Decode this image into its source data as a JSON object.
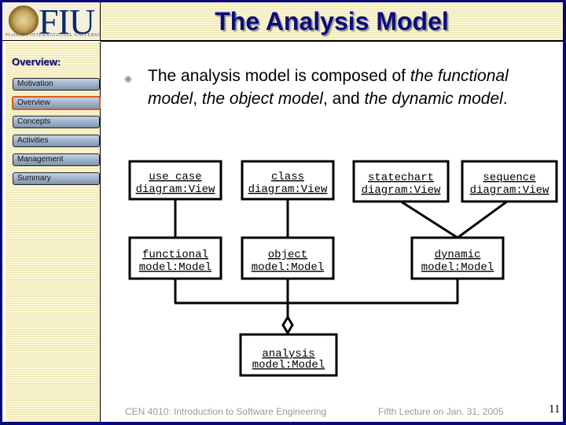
{
  "header": {
    "logo_text": "FIU",
    "logo_subtext": "FLORIDA INTERNATIONAL UNIVERSITY",
    "title": "The Analysis Model"
  },
  "sidebar": {
    "heading": "Overview:",
    "active_index": 1,
    "items": [
      {
        "label": "Motivation"
      },
      {
        "label": "Overview"
      },
      {
        "label": "Concepts"
      },
      {
        "label": "Activities"
      },
      {
        "label": "Management"
      },
      {
        "label": "Summary"
      }
    ]
  },
  "content": {
    "bullet": {
      "part1": "The analysis model is composed of ",
      "part2_italic": "the functional model",
      "part3": ", ",
      "part4_italic": "the object model",
      "part5": ", and ",
      "part6_italic": "the dynamic model",
      "part7": "."
    }
  },
  "diagram": {
    "nodes": {
      "use_case_view": {
        "line1": "use case",
        "line2": "diagram:View"
      },
      "class_view": {
        "line1": "class",
        "line2": "diagram:View"
      },
      "statechart_view": {
        "line1": "statechart",
        "line2": "diagram:View"
      },
      "sequence_view": {
        "line1": "sequence",
        "line2": "diagram:View"
      },
      "functional_model": {
        "line1": "functional",
        "line2": "model:Model"
      },
      "object_model": {
        "line1": "object",
        "line2": "model:Model"
      },
      "dynamic_model": {
        "line1": "dynamic",
        "line2": "model:Model"
      },
      "analysis_model": {
        "line1": "analysis",
        "line2": "model:Model"
      }
    },
    "edges": [
      {
        "from": "use_case_view",
        "to": "functional_model",
        "type": "link"
      },
      {
        "from": "class_view",
        "to": "object_model",
        "type": "link"
      },
      {
        "from": "statechart_view",
        "to": "dynamic_model",
        "type": "link"
      },
      {
        "from": "sequence_view",
        "to": "dynamic_model",
        "type": "link"
      },
      {
        "from": "functional_model",
        "to": "analysis_model",
        "type": "aggregation"
      },
      {
        "from": "object_model",
        "to": "analysis_model",
        "type": "aggregation"
      },
      {
        "from": "dynamic_model",
        "to": "analysis_model",
        "type": "aggregation"
      }
    ]
  },
  "footer": {
    "course": "CEN 4010: Introduction to Software Engineering",
    "lecture": "Fifth Lecture on Jan. 31, 2005",
    "page": "11"
  }
}
